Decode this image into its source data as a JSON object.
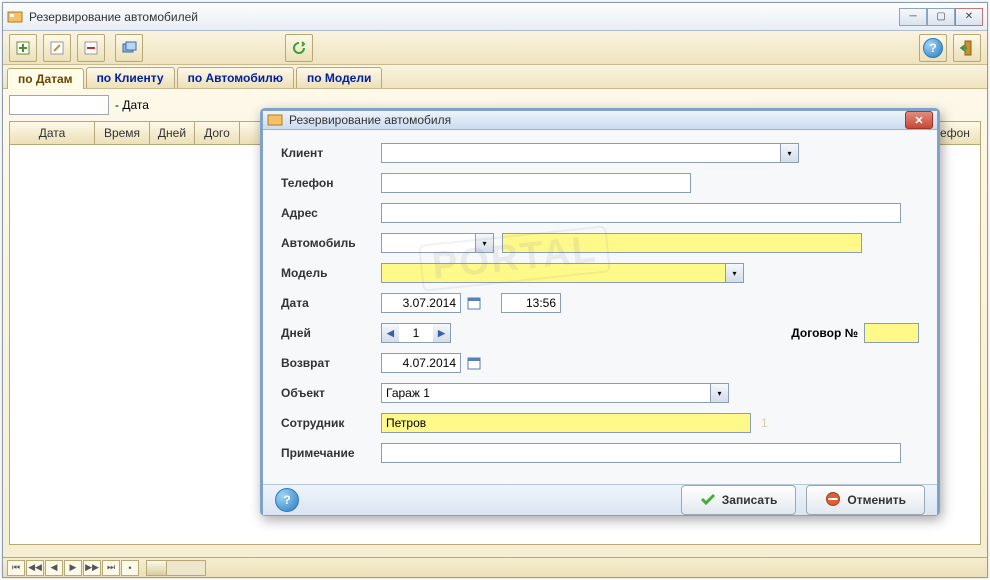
{
  "window": {
    "title": "Резервирование автомобилей"
  },
  "tabs": [
    {
      "label": "по Датам",
      "active": true
    },
    {
      "label": "по Клиенту",
      "active": false
    },
    {
      "label": "по Автомобилю",
      "active": false
    },
    {
      "label": "по Модели",
      "active": false
    }
  ],
  "filter": {
    "suffix": "- Дата"
  },
  "grid": {
    "columns": [
      "Дата",
      "Время",
      "Дней",
      "Дого",
      "Телефон"
    ]
  },
  "modal": {
    "title": "Резервирование автомобиля",
    "labels": {
      "client": "Клиент",
      "phone": "Телефон",
      "address": "Адрес",
      "car": "Автомобиль",
      "model": "Модель",
      "date": "Дата",
      "days": "Дней",
      "contract": "Договор №",
      "return": "Возврат",
      "object": "Объект",
      "employee": "Сотрудник",
      "note": "Примечание"
    },
    "values": {
      "client": "",
      "phone": "",
      "address": "",
      "car": "",
      "car_desc": "",
      "model": "",
      "date": "3.07.2014",
      "time": "13:56",
      "days": "1",
      "contract": "",
      "return": "4.07.2014",
      "object": "Гараж 1",
      "employee": "Петров",
      "employee_num": "1",
      "note": ""
    },
    "buttons": {
      "save": "Записать",
      "cancel": "Отменить"
    }
  },
  "watermark": "PORTAL"
}
